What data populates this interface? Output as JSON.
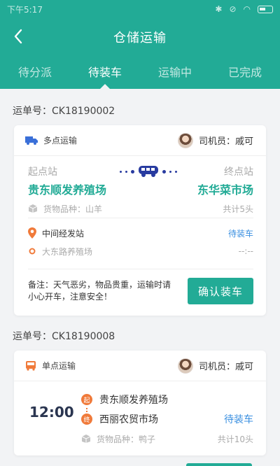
{
  "statusbar": {
    "time": "下午5:17",
    "icons": [
      "bluetooth-icon",
      "mute-icon",
      "wifi-icon",
      "battery-icon"
    ]
  },
  "titlebar": {
    "title": "仓储运输"
  },
  "tabs": [
    {
      "label": "待分派",
      "active": false
    },
    {
      "label": "待装车",
      "active": true
    },
    {
      "label": "运输中",
      "active": false
    },
    {
      "label": "已完成",
      "active": false
    }
  ],
  "orders": [
    {
      "waybill": "运单号：CK18190002",
      "type": "多点运输",
      "driver": "司机员：戚可",
      "start_label": "起点站",
      "end_label": "终点站",
      "start": "贵东顺发养殖场",
      "end": "东华菜市场",
      "goods": "货物品种：山羊",
      "count": "共计5头",
      "mid_label": "中间经发站",
      "mid_status": "待装车",
      "mid_station": "大东路养殖场",
      "mid_time": "--:--",
      "note": "备注：天气恶劣，物品贵重，运输时请小心开车，注意安全！",
      "button": "确认装车"
    },
    {
      "waybill": "运单号：CK18190008",
      "type": "单点运输",
      "driver": "司机员：戚可",
      "time": "12:00",
      "start": "贵东顺发养殖场",
      "end": "西丽农贸市场",
      "start_mark": "起",
      "end_mark": "终",
      "status": "待装车",
      "goods": "货物品种：鸭子",
      "count": "共计10头"
    }
  ],
  "colors": {
    "primary": "#22ab96",
    "link": "#3a8fe0",
    "accent": "#f07a3a",
    "truck": "#283ba0"
  }
}
